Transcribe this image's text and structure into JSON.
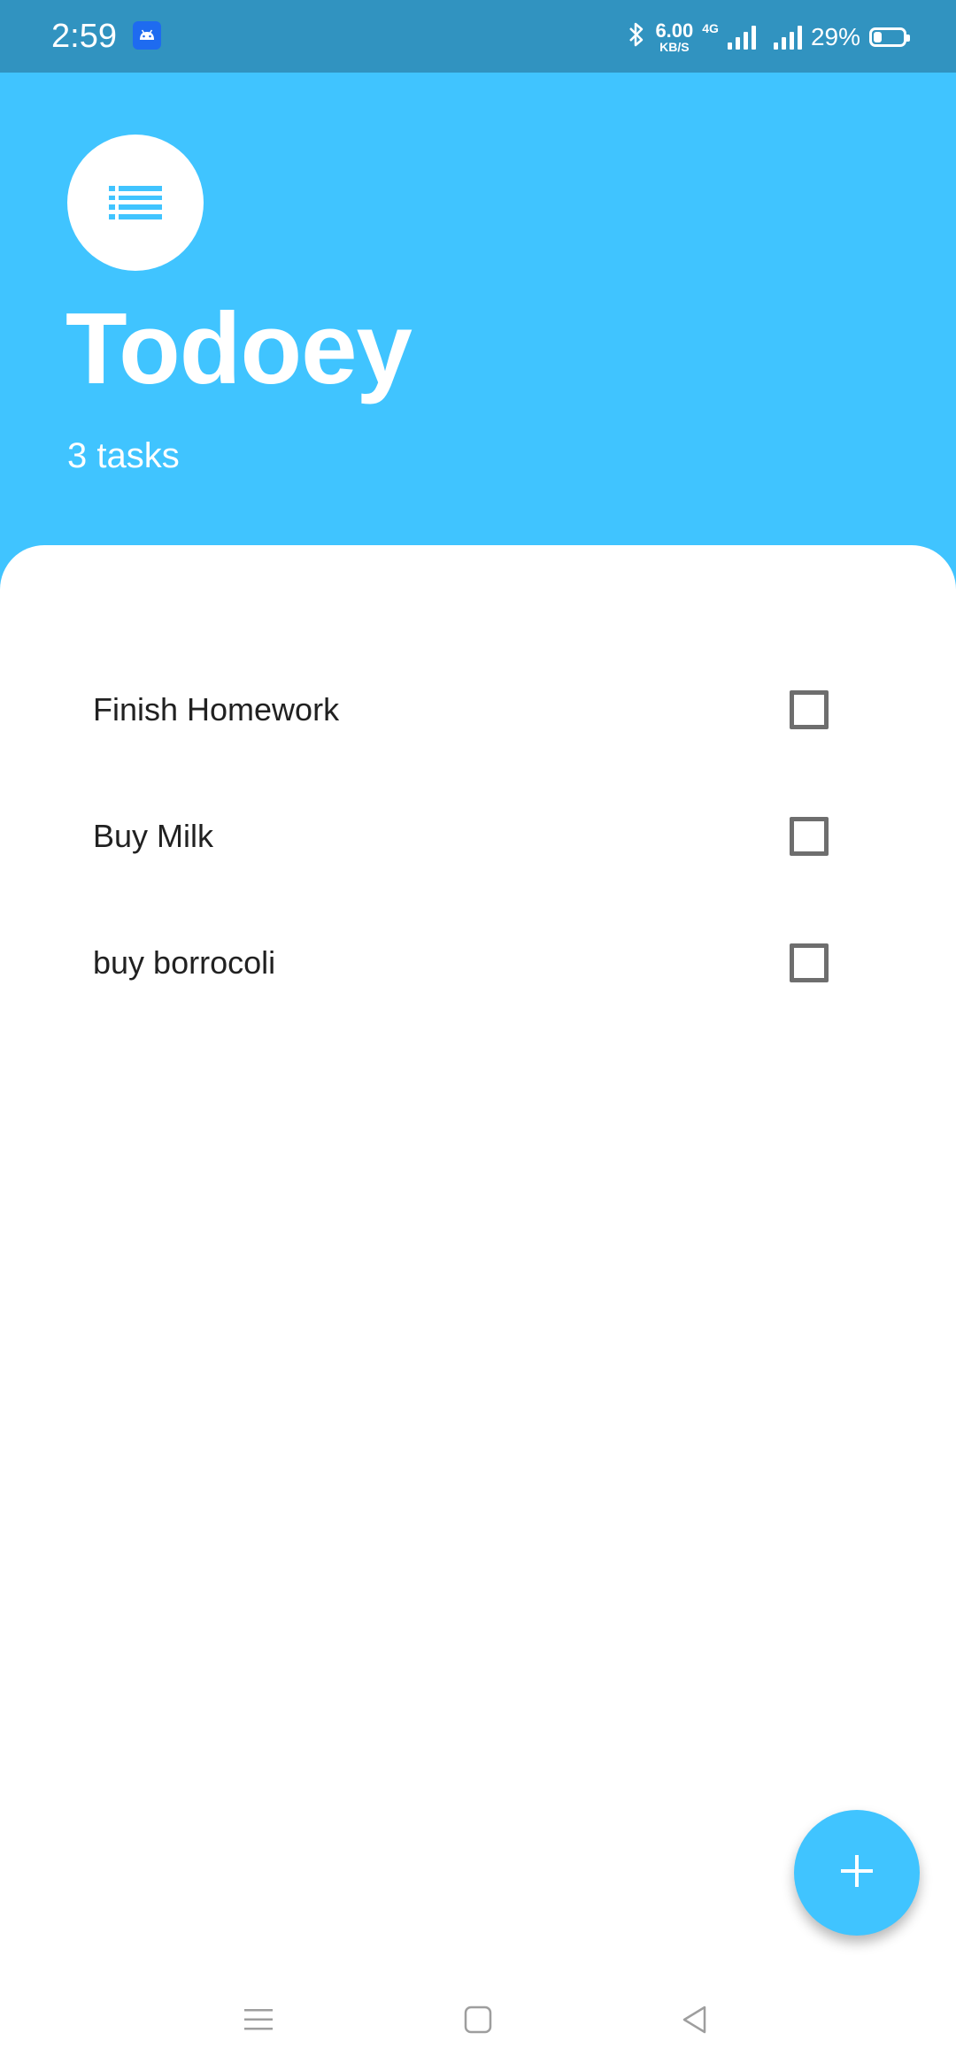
{
  "status_bar": {
    "time": "2:59",
    "network_speed": "6.00",
    "network_speed_unit": "KB/S",
    "network_type": "4G",
    "battery_percent": "29%",
    "battery_level": 0.29,
    "icons": [
      "android-app-icon",
      "bluetooth-icon",
      "signal-icon",
      "signal-icon",
      "battery-icon"
    ]
  },
  "header": {
    "icon": "list-icon",
    "title": "Todoey",
    "task_count": "3 tasks"
  },
  "tasks": [
    {
      "title": "Finish Homework",
      "done": false
    },
    {
      "title": "Buy Milk",
      "done": false
    },
    {
      "title": "buy borrocoli",
      "done": false
    }
  ],
  "fab": {
    "icon": "plus-icon"
  },
  "nav_bar": {
    "icons": [
      "menu-icon",
      "home-icon",
      "back-icon"
    ]
  },
  "colors": {
    "primary": "#40C4FF",
    "status_bar": "#3193C0",
    "text": "#212121",
    "checkbox_border": "#6E6E6E"
  }
}
